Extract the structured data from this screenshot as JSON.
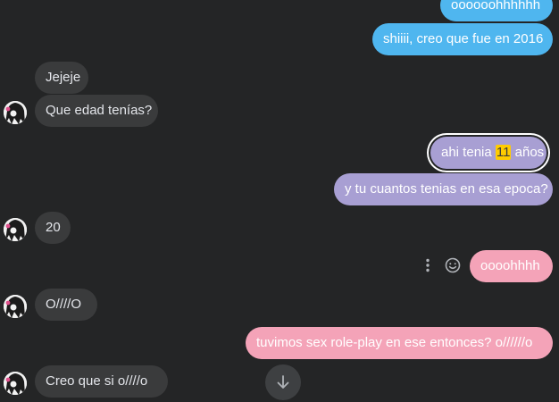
{
  "messages": [
    {
      "text": "oooooohhhhhh"
    },
    {
      "text": "shiiii, creo que fue en 2016"
    },
    {
      "text": "Jejeje"
    },
    {
      "text": "Que edad tenías?"
    },
    {
      "before": "ahi tenia ",
      "highlight": "11",
      "after": " años"
    },
    {
      "text": "y tu cuantos tenias en esa epoca?"
    },
    {
      "text": "20"
    },
    {
      "text": "oooohhhh"
    },
    {
      "text": "O////O"
    },
    {
      "text": "tuvimos sex role-play en ese entonces? o//////o"
    },
    {
      "text": "Creo que si o////o"
    }
  ],
  "icons": {
    "more": "more-vertical-icon",
    "react": "smiley-icon",
    "scroll": "arrow-down-icon"
  },
  "colors": {
    "background": "#242526",
    "incoming": "#3a3b3c",
    "outgoing_blue": "#4fb6ef",
    "outgoing_purple": "#a89fd3",
    "outgoing_pink": "#f4a3b8",
    "highlight": "#ffcc00"
  }
}
